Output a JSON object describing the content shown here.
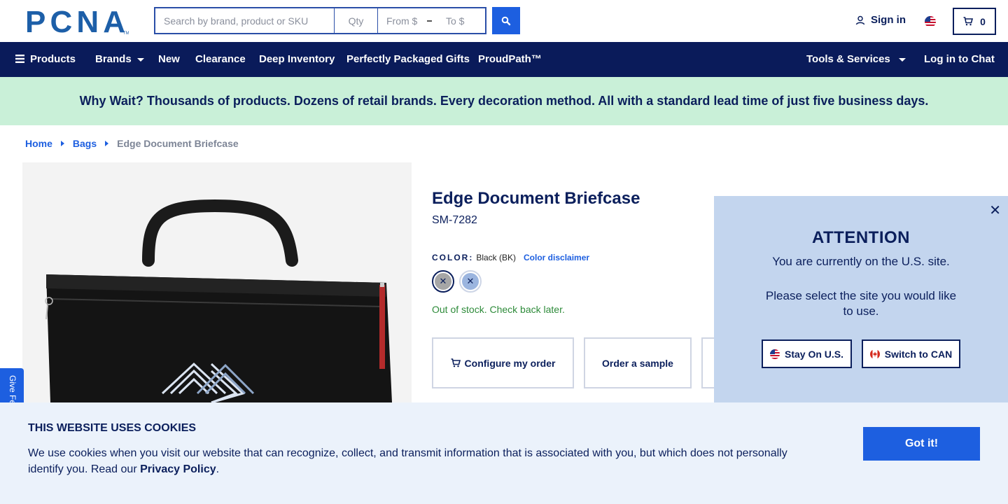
{
  "header": {
    "logo_text": "PCNA",
    "search_placeholder": "Search by brand, product or SKU",
    "qty_placeholder": "Qty",
    "price_from_placeholder": "From $",
    "price_to_placeholder": "To $",
    "signin_label": "Sign in",
    "cart_count": "0"
  },
  "nav": {
    "products": "Products",
    "brands": "Brands",
    "new": "New",
    "clearance": "Clearance",
    "deep_inventory": "Deep Inventory",
    "gifts": "Perfectly Packaged Gifts",
    "proudpath": "ProudPath™",
    "tools": "Tools & Services",
    "chat": "Log in to Chat"
  },
  "banner": {
    "text": "Why Wait? Thousands of products. Dozens of retail brands. Every decoration method. All with a standard lead time of just five business days."
  },
  "breadcrumb": {
    "home": "Home",
    "bags": "Bags",
    "current": "Edge Document Briefcase"
  },
  "product": {
    "title": "Edge Document Briefcase",
    "sku": "SM-7282",
    "color_label": "COLOR:",
    "color_value": "Black (BK)",
    "color_disclaimer": "Color disclaimer",
    "stock_status": "Out of stock. Check back later.",
    "configure_label": "Configure my order",
    "sample_label": "Order a sample",
    "swatch_mark": "✕"
  },
  "popup": {
    "heading": "ATTENTION",
    "line1": "You are currently on the U.S. site.",
    "line2": "Please select the site you would like to use.",
    "stay_label": "Stay On U.S.",
    "switch_label": "Switch to CAN",
    "close_glyph": "✕"
  },
  "feedback": {
    "label": "Give Fe"
  },
  "cookie": {
    "title": "THIS WEBSITE USES COOKIES",
    "text": "We use cookies when you visit our website that can recognize, collect, and transmit information that is associated with you, but which does not personally identify you. Read our ",
    "policy_link": "Privacy Policy",
    "period": ".",
    "button": "Got it!"
  },
  "colors": {
    "navy": "#0a1b5a",
    "accent_blue": "#1d5fe0",
    "banner_green": "#c9f0d8",
    "popup_bg": "#c3d5ee",
    "cookie_bg": "#ebf2fb",
    "stock_green": "#2e8b3a"
  }
}
